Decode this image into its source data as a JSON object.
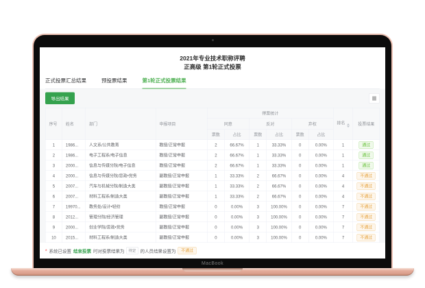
{
  "device": {
    "label": "MacBook"
  },
  "header": {
    "title_line1": "2021年专业技术职称评聘",
    "title_line2": "正高级 第1轮正式投票"
  },
  "tabs": [
    {
      "label": "正式投票汇总结果",
      "active": false
    },
    {
      "label": "预投票结果",
      "active": false
    },
    {
      "label": "第1轮正式投票结果",
      "active": true
    }
  ],
  "toolbar": {
    "export_label": "导出结果",
    "column_settings_icon": "grid-icon"
  },
  "table": {
    "columns": {
      "no": "序号",
      "name": "姓名",
      "dept": "部门",
      "project": "申报项目",
      "stats_group": "得票统计",
      "agree": "同意",
      "oppose": "反对",
      "abstain": "弃权",
      "votes": "票数",
      "pct": "占比",
      "rank": "排名",
      "result": "投票结果"
    },
    "rows": [
      {
        "no": "1",
        "name": "1986...",
        "dept": "人文系/公共教育",
        "project": "教授/正常申报",
        "agree_votes": "2",
        "agree_pct": "66.67%",
        "oppose_votes": "1",
        "oppose_pct": "33.33%",
        "abstain_votes": "0",
        "abstain_pct": "0.00%",
        "rank": "1",
        "result": "通过",
        "result_type": "pass"
      },
      {
        "no": "2",
        "name": "1986...",
        "dept": "电子工程系/电子信息",
        "project": "教授/正常申报",
        "agree_votes": "2",
        "agree_pct": "66.67%",
        "oppose_votes": "1",
        "oppose_pct": "33.33%",
        "abstain_votes": "0",
        "abstain_pct": "0.00%",
        "rank": "1",
        "result": "通过",
        "result_type": "pass"
      },
      {
        "no": "3",
        "name": "2000...",
        "dept": "信息与传媒分院/电子信息",
        "project": "教授/正常申报",
        "agree_votes": "2",
        "agree_pct": "66.67%",
        "oppose_votes": "1",
        "oppose_pct": "33.33%",
        "abstain_votes": "0",
        "abstain_pct": "0.00%",
        "rank": "1",
        "result": "通过",
        "result_type": "pass"
      },
      {
        "no": "4",
        "name": "2000...",
        "dept": "信息与传媒分院/思政•党务",
        "project": "副教授/正常申报",
        "agree_votes": "1",
        "agree_pct": "33.33%",
        "oppose_votes": "2",
        "oppose_pct": "66.67%",
        "abstain_votes": "0",
        "abstain_pct": "0.00%",
        "rank": "4",
        "result": "不通过",
        "result_type": "fail"
      },
      {
        "no": "5",
        "name": "2007...",
        "dept": "汽车与机械分院/制造大类",
        "project": "副教授/正常申报",
        "agree_votes": "1",
        "agree_pct": "33.33%",
        "oppose_votes": "2",
        "oppose_pct": "66.67%",
        "abstain_votes": "0",
        "abstain_pct": "0.00%",
        "rank": "4",
        "result": "不通过",
        "result_type": "fail"
      },
      {
        "no": "6",
        "name": "2007...",
        "dept": "材料工程系/制造大类",
        "project": "副教授/正常申报",
        "agree_votes": "1",
        "agree_pct": "33.33%",
        "oppose_votes": "2",
        "oppose_pct": "66.67%",
        "abstain_votes": "0",
        "abstain_pct": "0.00%",
        "rank": "4",
        "result": "不通过",
        "result_type": "fail"
      },
      {
        "no": "7",
        "name": "19970...",
        "dept": "教务处/设计•轻纺",
        "project": "教授/正常申报",
        "agree_votes": "0",
        "agree_pct": "0.00%",
        "oppose_votes": "3",
        "oppose_pct": "100.00%",
        "abstain_votes": "0",
        "abstain_pct": "0.00%",
        "rank": "7",
        "result": "不通过",
        "result_type": "fail"
      },
      {
        "no": "8",
        "name": "2012...",
        "dept": "管理分院/经济管理",
        "project": "副教授/正常申报",
        "agree_votes": "0",
        "agree_pct": "0.00%",
        "oppose_votes": "3",
        "oppose_pct": "100.00%",
        "abstain_votes": "0",
        "abstain_pct": "0.00%",
        "rank": "7",
        "result": "不通过",
        "result_type": "fail"
      },
      {
        "no": "9",
        "name": "2000...",
        "dept": "创业学院/思政•党务",
        "project": "副教授/正常申报",
        "agree_votes": "0",
        "agree_pct": "0.00%",
        "oppose_votes": "3",
        "oppose_pct": "100.00%",
        "abstain_votes": "0",
        "abstain_pct": "0.00%",
        "rank": "7",
        "result": "不通过",
        "result_type": "fail"
      },
      {
        "no": "10",
        "name": "2015...",
        "dept": "材料工程系/制造大类",
        "project": "副教授/正常申报",
        "agree_votes": "0",
        "agree_pct": "0.00%",
        "oppose_votes": "3",
        "oppose_pct": "100.00%",
        "abstain_votes": "0",
        "abstain_pct": "0.00%",
        "rank": "7",
        "result": "不通过",
        "result_type": "fail"
      }
    ]
  },
  "footnote": {
    "star": "*",
    "part1": "系统已设置",
    "highlight": "结束投票",
    "part2": "时对投票结果为",
    "pending_tag": "待定",
    "part3": "的人员结果设置为",
    "fail_tag": "不通过"
  },
  "colors": {
    "tab_active": "#4caf50",
    "button_green": "#35a24e",
    "pass": "#67c23a",
    "pass_bg": "#f0f9eb",
    "fail": "#e6a23c",
    "fail_bg": "#fdf6ec",
    "laptop_body": "#e2a794"
  }
}
